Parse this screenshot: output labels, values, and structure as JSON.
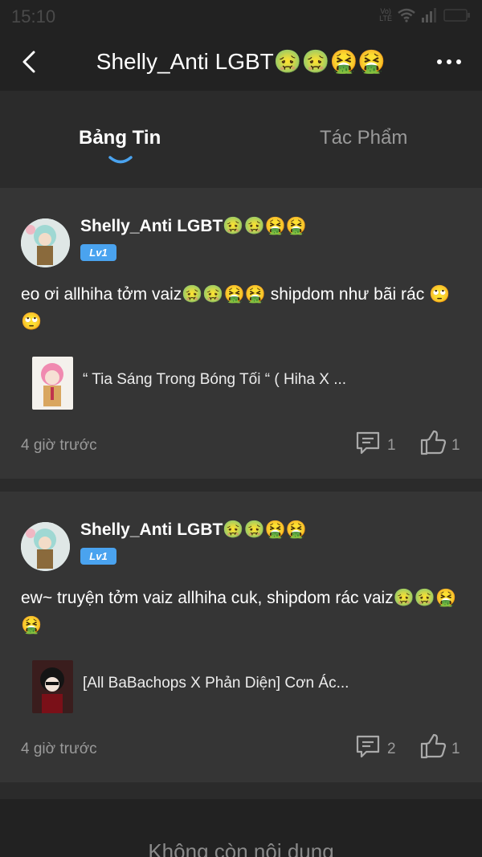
{
  "status_bar": {
    "time": "15:10",
    "network": "Vo) LTE"
  },
  "header": {
    "title": "Shelly_Anti LGBT🤢🤢🤮🤮"
  },
  "tabs": [
    {
      "label": "Bảng Tin",
      "active": true
    },
    {
      "label": "Tác Phẩm",
      "active": false
    }
  ],
  "posts": [
    {
      "username": "Shelly_Anti LGBT🤢🤢🤮🤮",
      "level": "Lv1",
      "text": "eo ơi allhiha tởm vaiz🤢🤢🤮🤮 shipdom như bãi rác 🙄🙄",
      "work_title": "“ Tia Sáng Trong Bóng Tối “ ( Hiha X ...",
      "time": "4 giờ trước",
      "comments": "1",
      "likes": "1"
    },
    {
      "username": "Shelly_Anti LGBT🤢🤢🤮🤮",
      "level": "Lv1",
      "text": "ew~ truyện tởm vaiz allhiha cuk, shipdom rác vaiz🤢🤢🤮🤮",
      "work_title": "[All BaBachops X Phản Diện] Cơn Ác...",
      "time": "4 giờ trước",
      "comments": "2",
      "likes": "1"
    }
  ],
  "footer": {
    "text": "Không còn nội dung"
  },
  "colors": {
    "accent": "#4aa3ef",
    "background": "#2b2b2b",
    "card": "#353535"
  }
}
